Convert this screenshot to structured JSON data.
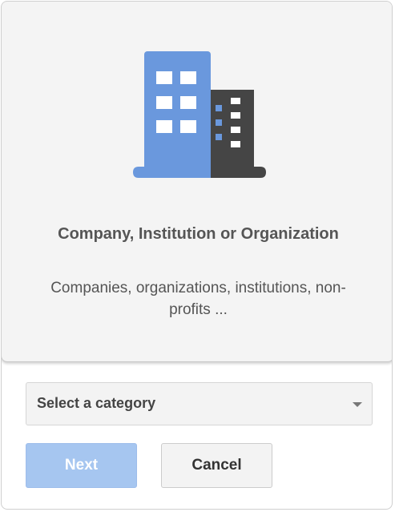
{
  "card": {
    "icon": "building-icon",
    "title": "Company, Institution or Organization",
    "description": "Companies, organizations, institutions, non-profits ..."
  },
  "category_select": {
    "value": "Select a category"
  },
  "buttons": {
    "next_label": "Next",
    "cancel_label": "Cancel"
  },
  "colors": {
    "icon_blue": "#6a98dd",
    "icon_dark": "#454545",
    "next_button_disabled": "#a6c6f0"
  }
}
